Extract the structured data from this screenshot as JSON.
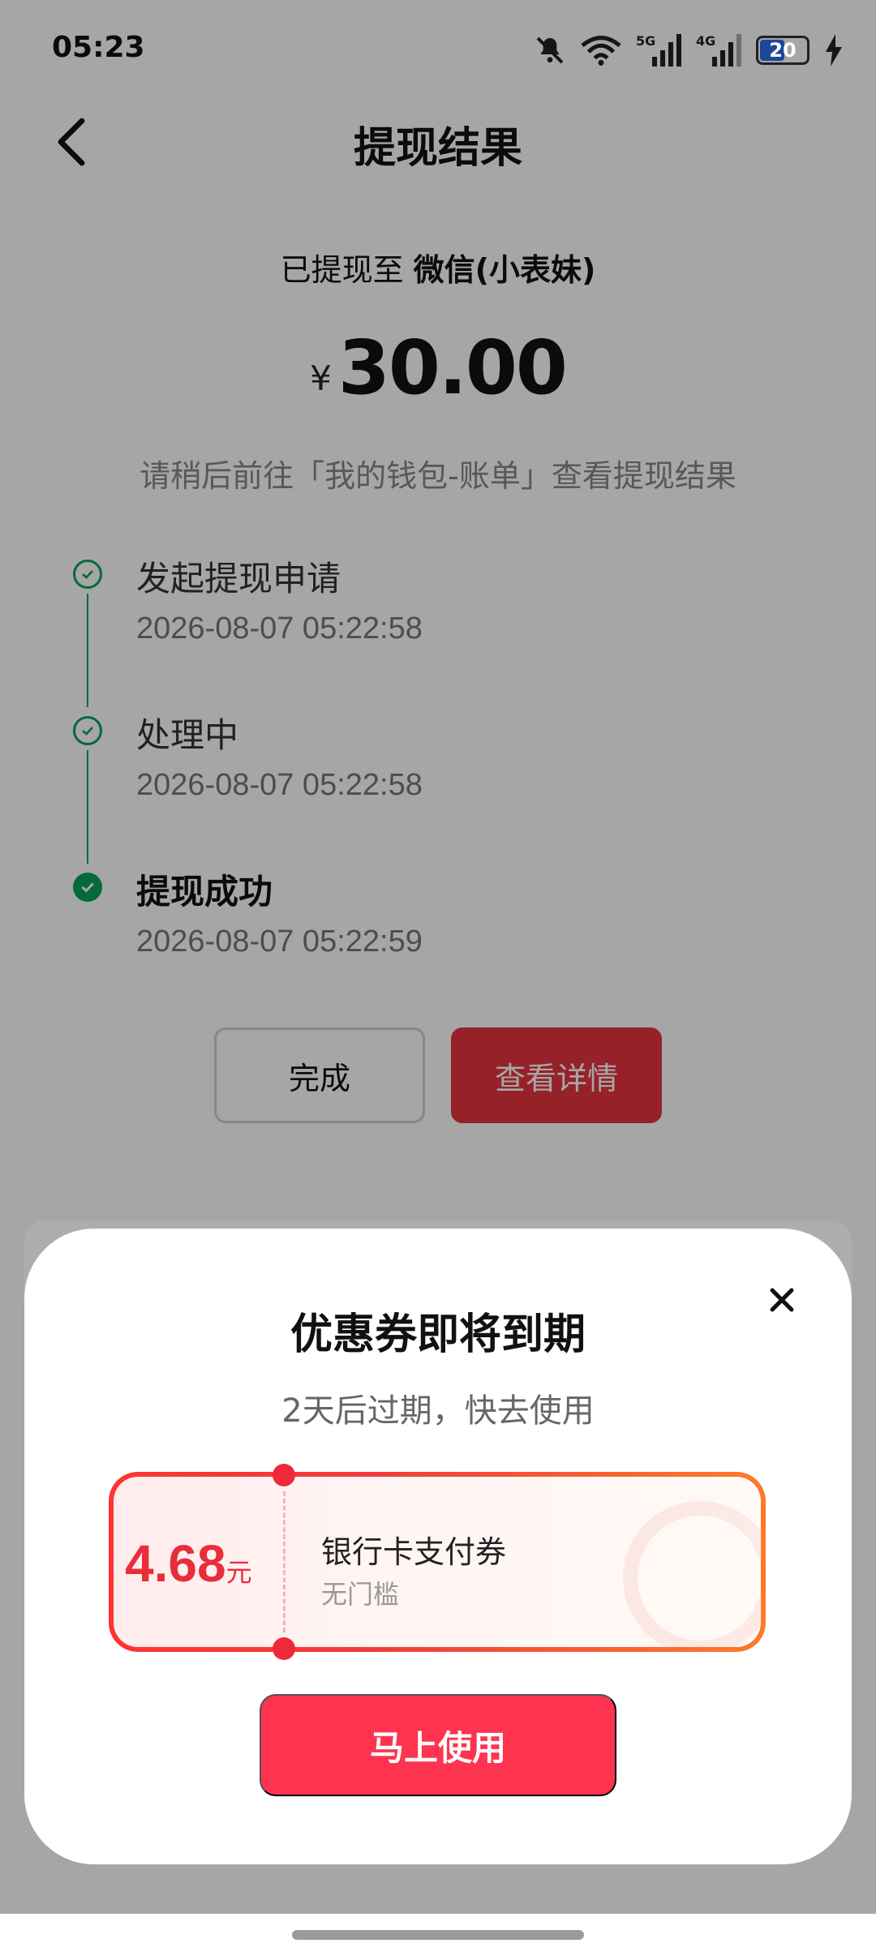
{
  "status_bar": {
    "time": "05:23",
    "network_labels": [
      "5G",
      "4G"
    ],
    "battery": "20",
    "battery_level": 0.2
  },
  "header": {
    "title": "提现结果"
  },
  "result": {
    "prefix": "已提现至",
    "target": "微信(小表妹)",
    "currency": "¥",
    "amount": "30.00",
    "hint": "请稍后前往「我的钱包-账单」查看提现结果"
  },
  "timeline": [
    {
      "title": "发起提现申请",
      "time": "2026-08-07 05:22:58",
      "state": "done"
    },
    {
      "title": "处理中",
      "time": "2026-08-07 05:22:58",
      "state": "done"
    },
    {
      "title": "提现成功",
      "time": "2026-08-07 05:22:59",
      "state": "current"
    }
  ],
  "buttons": {
    "done": "完成",
    "detail": "查看详情"
  },
  "modal": {
    "title": "优惠券即将到期",
    "subtitle": "2天后过期，快去使用",
    "coupon": {
      "value": "4.68",
      "unit": "元",
      "name": "银行卡支付券",
      "threshold": "无门槛"
    },
    "use_button": "马上使用"
  },
  "colors": {
    "accent_green": "#07a35a",
    "detail_red": "#e8343e",
    "coupon_red": "#ea2d3b",
    "use_button": "#fe334f"
  }
}
